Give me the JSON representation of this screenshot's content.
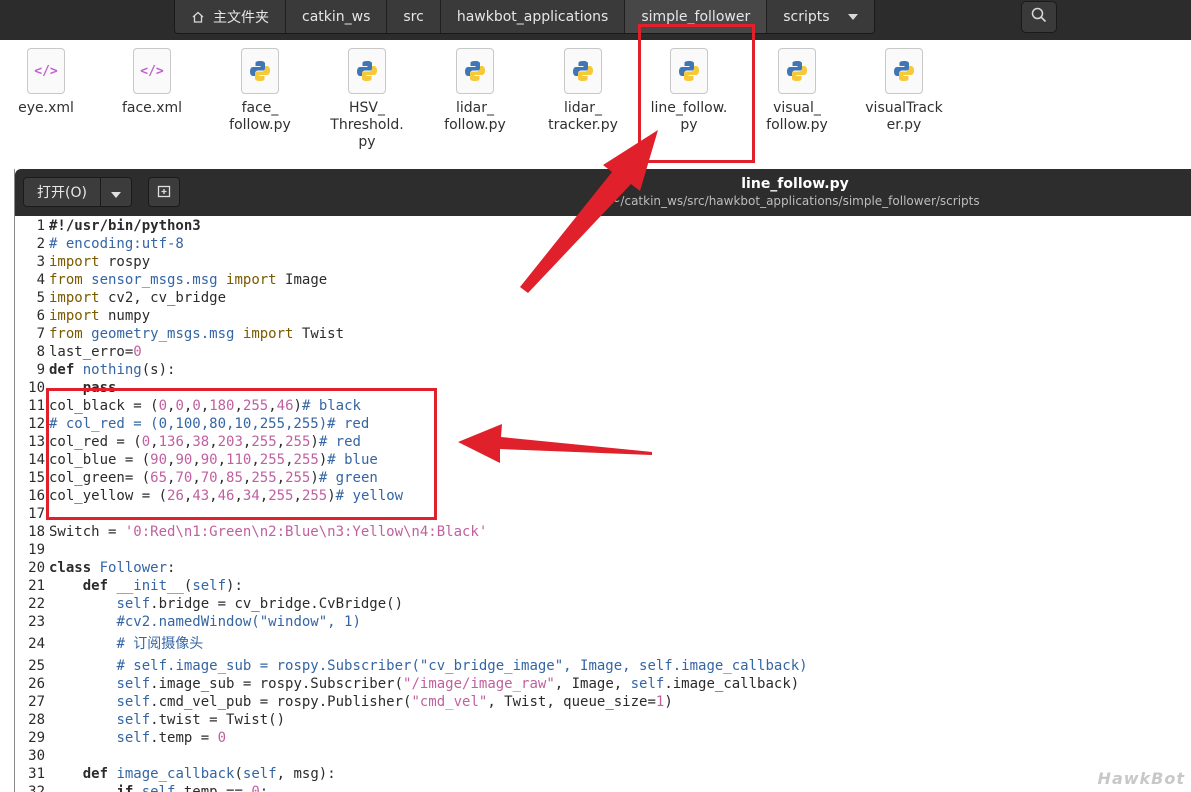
{
  "breadcrumb": {
    "items": [
      "主文件夹",
      "catkin_ws",
      "src",
      "hawkbot_applications",
      "simple_follower",
      "scripts"
    ],
    "active_index": 4
  },
  "files": [
    {
      "name": "eye.xml",
      "type": "xml"
    },
    {
      "name": "face.xml",
      "type": "xml"
    },
    {
      "name": "face_\nfollow.py",
      "type": "python"
    },
    {
      "name": "HSV_\nThreshold.\npy",
      "type": "python"
    },
    {
      "name": "lidar_\nfollow.py",
      "type": "python"
    },
    {
      "name": "lidar_\ntracker.py",
      "type": "python"
    },
    {
      "name": "line_follow.\npy",
      "type": "python",
      "highlighted": true
    },
    {
      "name": "visual_\nfollow.py",
      "type": "python"
    },
    {
      "name": "visualTrack\ner.py",
      "type": "python"
    }
  ],
  "editor": {
    "open_label": "打开(O)",
    "title": "line_follow.py",
    "path": "~/catkin_ws/src/hawkbot_applications/simple_follower/scripts",
    "line_numbers": [
      "1",
      "2",
      "3",
      "4",
      "5",
      "6",
      "7",
      "8",
      "9",
      "10",
      "11",
      "12",
      "13",
      "14",
      "15",
      "16",
      "17",
      "18",
      "19",
      "20",
      "21",
      "22",
      "23",
      "24",
      "25",
      "26",
      "27",
      "28",
      "29",
      "30",
      "31",
      "32"
    ]
  },
  "watermark": "HawkBot",
  "colors": {
    "highlight": "#e0202a",
    "dark_chrome": "#2c2c2c",
    "comment": "#3465a4",
    "number": "#c060a0"
  },
  "icons": [
    "home-icon",
    "search-icon",
    "chevron-down-icon",
    "new-tab-icon",
    "xml-file-icon",
    "python-file-icon"
  ]
}
